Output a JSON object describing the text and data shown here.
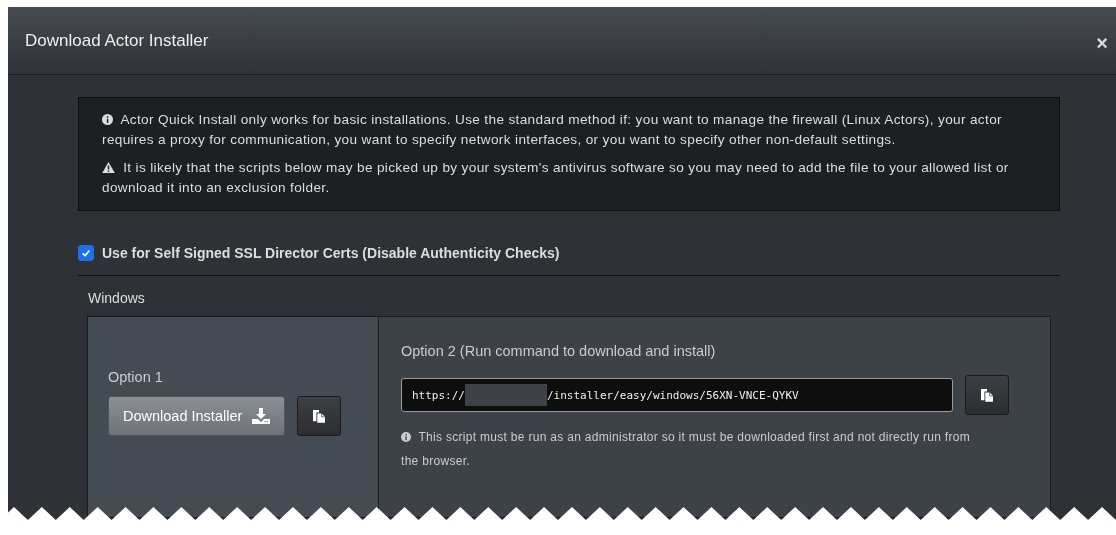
{
  "dialog": {
    "title": "Download Actor Installer",
    "close": "×"
  },
  "notices": [
    {
      "kind": "info",
      "text": "Actor Quick Install only works for basic installations. Use the standard method if: you want to manage the firewall (Linux Actors), your actor requires a proxy for communication, you want to specify network interfaces, or you want to specify other non-default settings."
    },
    {
      "kind": "warning",
      "text": "It is likely that the scripts below may be picked up by your system's antivirus software so you may need to add the file to your allowed list or download it into an exclusion folder."
    }
  ],
  "self_signed": {
    "label": "Use for Self Signed SSL Director Certs (Disable Authenticity Checks)",
    "checked": true
  },
  "section": {
    "title": "Windows",
    "option1": {
      "title": "Option 1",
      "button": "Download Installer"
    },
    "option2": {
      "title": "Option 2 (Run command to download and install)",
      "command_start": "https://",
      "command_redacted": true,
      "command_end": "/installer/easy/windows/56XN-VNCE-QYKV",
      "note": "This script must be run as an administrator so it must be downloaded first and not directly run from the browser."
    }
  }
}
